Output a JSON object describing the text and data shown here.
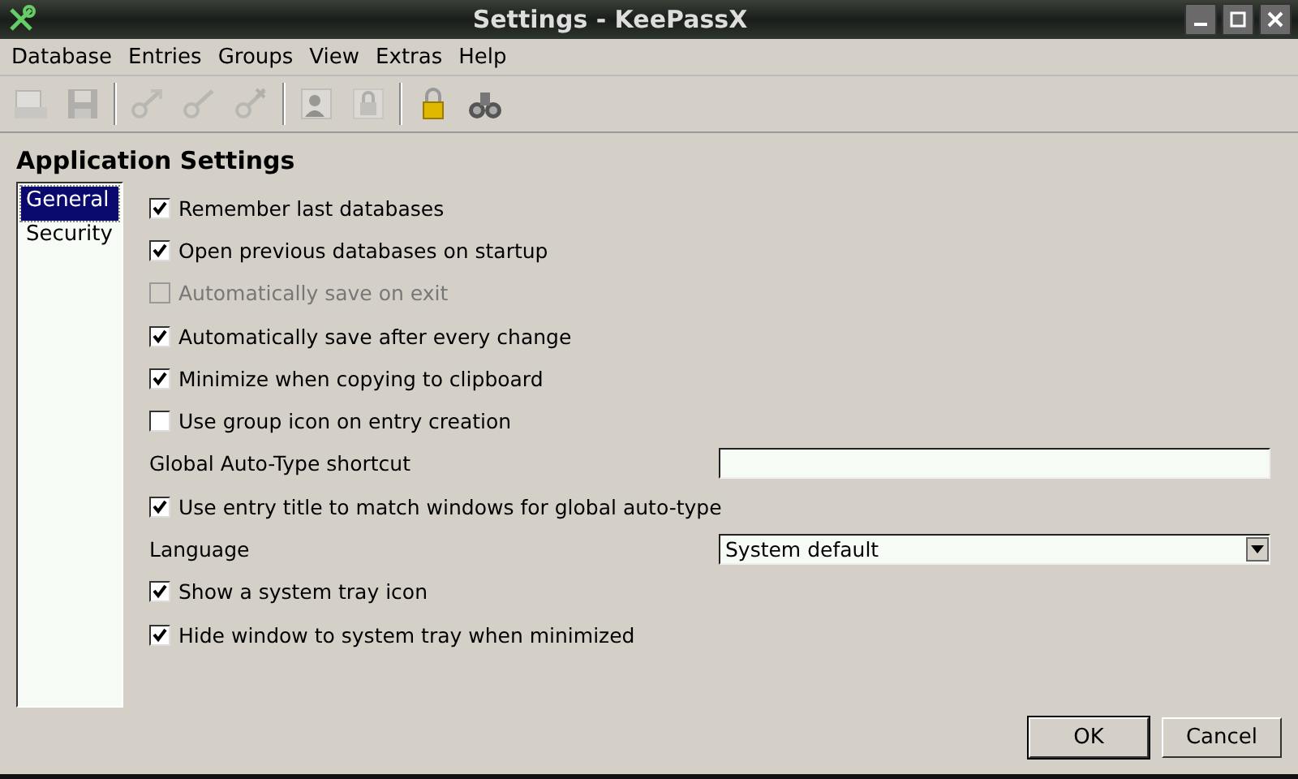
{
  "window": {
    "title": "Settings - KeePassX"
  },
  "menu": [
    "Database",
    "Entries",
    "Groups",
    "View",
    "Extras",
    "Help"
  ],
  "toolbar": [
    {
      "kind": "open",
      "disabled": true
    },
    {
      "kind": "save",
      "disabled": true
    },
    {
      "kind": "sep"
    },
    {
      "kind": "key-add",
      "disabled": true
    },
    {
      "kind": "key-edit",
      "disabled": true
    },
    {
      "kind": "key-delete",
      "disabled": true
    },
    {
      "kind": "sep"
    },
    {
      "kind": "person",
      "disabled": true
    },
    {
      "kind": "padlock-doc",
      "disabled": true
    },
    {
      "kind": "sep"
    },
    {
      "kind": "lock",
      "disabled": false
    },
    {
      "kind": "binoculars",
      "disabled": false
    }
  ],
  "heading": "Application Settings",
  "sections": [
    {
      "label": "General",
      "selected": true
    },
    {
      "label": "Security",
      "selected": false
    }
  ],
  "options": [
    {
      "kind": "checkbox",
      "label": "Remember last databases",
      "checked": true,
      "disabled": false
    },
    {
      "kind": "checkbox",
      "label": "Open previous databases on startup",
      "checked": true,
      "disabled": false
    },
    {
      "kind": "checkbox",
      "label": "Automatically save on exit",
      "checked": false,
      "disabled": true
    },
    {
      "kind": "checkbox",
      "label": "Automatically save after every change",
      "checked": true,
      "disabled": false
    },
    {
      "kind": "checkbox",
      "label": "Minimize when copying to clipboard",
      "checked": true,
      "disabled": false
    },
    {
      "kind": "checkbox",
      "label": "Use group icon on entry creation",
      "checked": false,
      "disabled": false
    },
    {
      "kind": "field",
      "label": "Global Auto-Type shortcut"
    },
    {
      "kind": "checkbox",
      "label": "Use entry title to match windows for global auto-type",
      "checked": true,
      "disabled": false
    },
    {
      "kind": "dropdown",
      "label": "Language",
      "value": "System default"
    },
    {
      "kind": "checkbox",
      "label": "Show a system tray icon",
      "checked": true,
      "disabled": false
    },
    {
      "kind": "checkbox",
      "label": "Hide window to system tray when minimized",
      "checked": true,
      "disabled": false
    }
  ],
  "buttons": [
    "OK",
    "Cancel"
  ]
}
